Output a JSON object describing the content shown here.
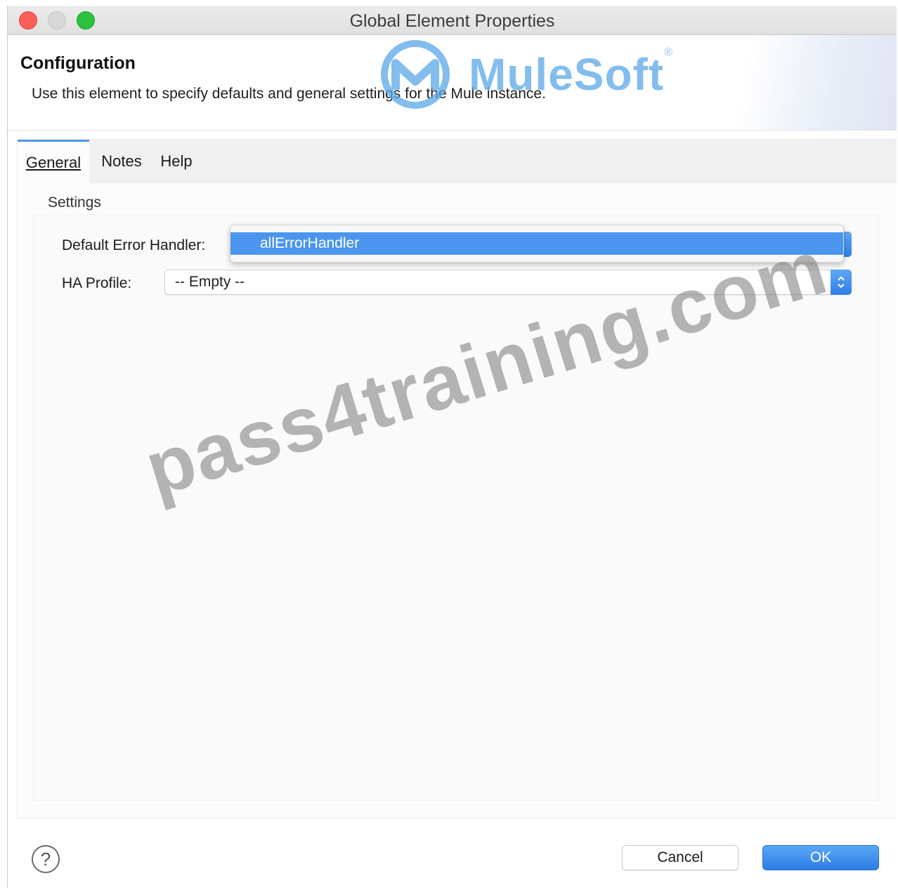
{
  "window": {
    "title": "Global Element Properties"
  },
  "header": {
    "title": "Configuration",
    "description": "Use this element to specify defaults and general settings for the Mule instance.",
    "brand": "MuleSoft"
  },
  "tabs": [
    {
      "label": "General",
      "active": true
    },
    {
      "label": "Notes",
      "active": false
    },
    {
      "label": "Help",
      "active": false
    }
  ],
  "settings": {
    "group_label": "Settings",
    "default_error_handler": {
      "label": "Default Error Handler:",
      "selected": "allErrorHandler"
    },
    "ha_profile": {
      "label": "HA Profile:",
      "selected": "-- Empty --"
    }
  },
  "watermark": "pass4training.com",
  "footer": {
    "help_icon": "?",
    "cancel_label": "Cancel",
    "ok_label": "OK"
  },
  "colors": {
    "accent": "#4b95ee",
    "close": "#fc5f57",
    "minimize": "#d8d8d8",
    "maximize": "#2cc140"
  }
}
